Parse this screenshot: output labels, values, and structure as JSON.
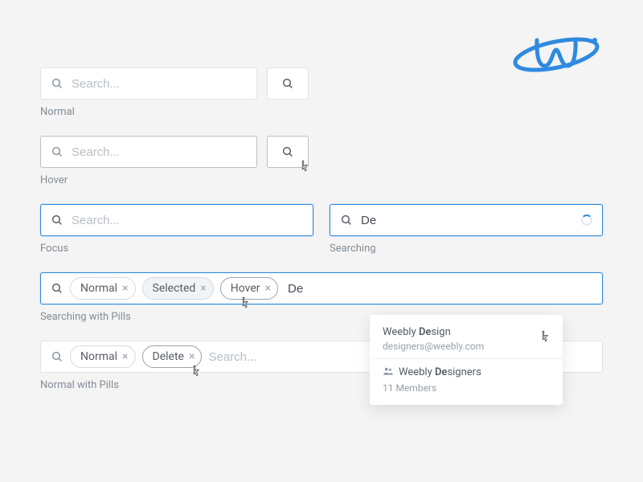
{
  "placeholder": "Search...",
  "states": {
    "normal": "Normal",
    "hover": "Hover",
    "focus": "Focus",
    "searching": "Searching",
    "searching_pills": "Searching with Pills",
    "normal_pills": "Normal with Pills"
  },
  "query": {
    "partial": "De"
  },
  "pills": {
    "normal": "Normal",
    "selected": "Selected",
    "hover": "Hover",
    "delete": "Delete"
  },
  "dropdown": {
    "item1": {
      "prefix": "Weebly ",
      "bold": "De",
      "suffix": "sign",
      "sub": "designers@weebly.com"
    },
    "item2": {
      "prefix": "Weebly ",
      "bold": "De",
      "suffix": "signers",
      "sub": "11 Members"
    }
  }
}
